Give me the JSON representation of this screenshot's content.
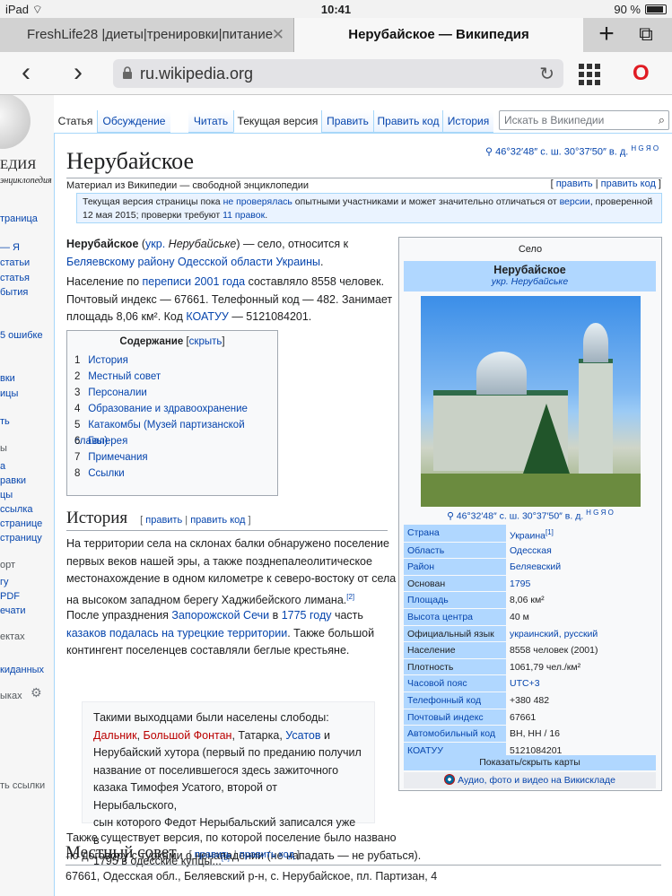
{
  "status": {
    "device": "iPad",
    "time": "10:41",
    "battery_text": "90 %",
    "battery_level": 0.9
  },
  "tabs": [
    {
      "title": "FreshLife28 |диеты|тренировки|питание",
      "active": false
    },
    {
      "title": "Нерубайское — Википедия",
      "active": true
    }
  ],
  "tab_buttons": {
    "new_tab": "+",
    "tabs_icon": "⧉"
  },
  "address": {
    "url": "ru.wikipedia.org"
  },
  "sidebar": {
    "logo_text": "ЕДИЯ",
    "logo_sub": "энциклопедия",
    "items": [
      {
        "label": "траница"
      },
      {
        "label": "— Я"
      },
      {
        "label": "статьи"
      },
      {
        "label": "статья"
      },
      {
        "label": "бытия"
      },
      {
        "label": "5 ошибке"
      },
      {
        "label": "вки"
      },
      {
        "label": "ицы"
      },
      {
        "label": "ть"
      },
      {
        "label": "а"
      },
      {
        "label": "равки"
      },
      {
        "label": "цы"
      },
      {
        "label": "ссылка"
      },
      {
        "label": "странице"
      },
      {
        "label": "страницу"
      },
      {
        "label": "гу"
      },
      {
        "label": "PDF"
      },
      {
        "label": "ечати"
      },
      {
        "label": "киданных"
      },
      {
        "label": "ыках"
      }
    ],
    "heads": [
      {
        "label": "ы"
      },
      {
        "label": "орт"
      },
      {
        "label": "ектах"
      },
      {
        "label": "ть ссылки"
      }
    ]
  },
  "page_tabs": {
    "article": "Статья",
    "talk": "Обсуждение",
    "read": "Читать",
    "current": "Текущая версия",
    "edit": "Править",
    "edit_code": "Править код",
    "history": "История",
    "search_placeholder": "Искать в Википедии"
  },
  "article": {
    "title": "Нерубайское",
    "coords": "46°32′48″ с. ш. 30°37′50″ в. д.",
    "coords_tools": "H G Я O",
    "from": "Материал из Википедии — свободной энциклопедии",
    "edit": "править",
    "edit_code": "править код",
    "notice": {
      "a": "Текущая версия страницы пока ",
      "link1": "не проверялась",
      "b": " опытными участниками и может значительно отличаться от ",
      "link2": "версии",
      "c": ", проверенной 12 мая 2015; проверки требуют ",
      "link3": "11 правок",
      "d": "."
    },
    "intro": {
      "bold": "Нерубайское",
      "p1_a": " (",
      "p1_link": "укр.",
      "p1_italic": " Нерубайське",
      "p1_b": ") — село, относится к",
      "p1_link2": "Беляевскому району Одесской области Украины",
      "p1_c": ".",
      "p2_a": "Население по ",
      "p2_link": "переписи 2001 года",
      "p2_b": " составляло 8558 человек.",
      "p2_line2": "Почтовый индекс — 67661. Телефонный код — 482. Занимает",
      "p2_line3a": "площадь 8,06 км². Код ",
      "p2_link2": "КОАТУУ",
      "p2_line3b": " — 5121084201."
    },
    "toc": {
      "title": "Содержание",
      "hide": "скрыть",
      "items": [
        {
          "n": "1",
          "label": "История"
        },
        {
          "n": "2",
          "label": "Местный совет"
        },
        {
          "n": "3",
          "label": "Персоналии"
        },
        {
          "n": "4",
          "label": "Образование и здравоохранение"
        },
        {
          "n": "5",
          "label": "Катакомбы (Музей партизанской славы)"
        },
        {
          "n": "6",
          "label": "Галерея"
        },
        {
          "n": "7",
          "label": "Примечания"
        },
        {
          "n": "8",
          "label": "Ссылки"
        }
      ]
    },
    "history": {
      "heading": "История",
      "p1_lines": [
        "На территории села на склонах балки обнаружено поселение",
        "первых веков нашей эры, а также позднепалеолитическое",
        "местонахождение в одном километре к северо-востоку от села",
        "на высоком западном берегу Хаджибейского лимана."
      ],
      "p1_ref": "[2]",
      "p2_a": "После упразднения ",
      "p2_link1": "Запорожской Сечи",
      "p2_b": " в ",
      "p2_link2": "1775 году",
      "p2_c": " часть",
      "p2_link3": "казаков подалась на турецкие территории",
      "p2_d": ". Также большой",
      "p2_line3": "контингент поселенцев составляли беглые крестьяне.",
      "quote": {
        "line1": "Такими выходцами были населены слободы:",
        "l_dalnik": "Дальник",
        "l_fontan": "Большой Фонтан",
        "tatarka": ", Татарка, ",
        "l_usatov": "Усатов",
        "and": " и",
        "line3": "Нерубайский хутора (первый по преданию получил",
        "line4": "название от поселившегося здесь зажиточного",
        "line5": "казака Тимофея Усатого, второй от Нерыбальского,",
        "line6": "сын которого Федот Нерыбальский записался уже в",
        "line7": "1795 в одесские купцы...",
        "ref": "[3]"
      },
      "p3_lines": [
        "Также существует версия, по которой поселение было названо",
        "по договору с турками о ненападении (не нападать — не рубаться)."
      ]
    },
    "council": {
      "heading": "Местный совет",
      "text": "67661, Одесская обл., Беляевский р-н, с. Нерубайское, пл. Партизан, 4"
    }
  },
  "infobox": {
    "kind": "Село",
    "title": "Нерубайское",
    "subtitle": "укр. Нерубайське",
    "coords": "46°32′48″ с. ш. 30°37′50″ в. д.",
    "coords_tools": "H G Я O",
    "rows": [
      {
        "k": "Страна",
        "v": "Украина",
        "ref": "[1]",
        "k_link": true,
        "v_link": true
      },
      {
        "k": "Область",
        "v": "Одесская",
        "ref": "",
        "k_link": true,
        "v_link": true
      },
      {
        "k": "Район",
        "v": "Беляевский",
        "ref": "",
        "k_link": true,
        "v_link": true
      },
      {
        "k": "Основан",
        "v": "1795",
        "ref": "",
        "k_link": false,
        "v_link": true
      },
      {
        "k": "Площадь",
        "v": "8,06 км²",
        "ref": "",
        "k_link": true,
        "v_link": false
      },
      {
        "k": "Высота центра",
        "v": "40 м",
        "ref": "",
        "k_link": true,
        "v_link": false
      },
      {
        "k": "Официальный язык",
        "v": "украинский, русский",
        "ref": "",
        "k_link": false,
        "v_link": true
      },
      {
        "k": "Население",
        "v": "8558 человек (2001)",
        "ref": "",
        "k_link": false,
        "v_link": false
      },
      {
        "k": "Плотность",
        "v": "1061,79 чел./км²",
        "ref": "",
        "k_link": false,
        "v_link": false
      },
      {
        "k": "Часовой пояс",
        "v": "UTC+3",
        "ref": "",
        "k_link": true,
        "v_link": true
      },
      {
        "k": "Телефонный код",
        "v": "+380 482",
        "ref": "",
        "k_link": true,
        "v_link": false
      },
      {
        "k": "Почтовый индекс",
        "v": "67661",
        "ref": "",
        "k_link": true,
        "v_link": false
      },
      {
        "k": "Автомобильный код",
        "v": "ВН, НН / 16",
        "ref": "",
        "k_link": true,
        "v_link": false
      },
      {
        "k": "КОАТУУ",
        "v": "5121084201",
        "ref": "",
        "k_link": true,
        "v_link": false
      }
    ],
    "toggle": "Показать/скрыть карты",
    "commons": "Аудио, фото и видео на Викискладе"
  }
}
